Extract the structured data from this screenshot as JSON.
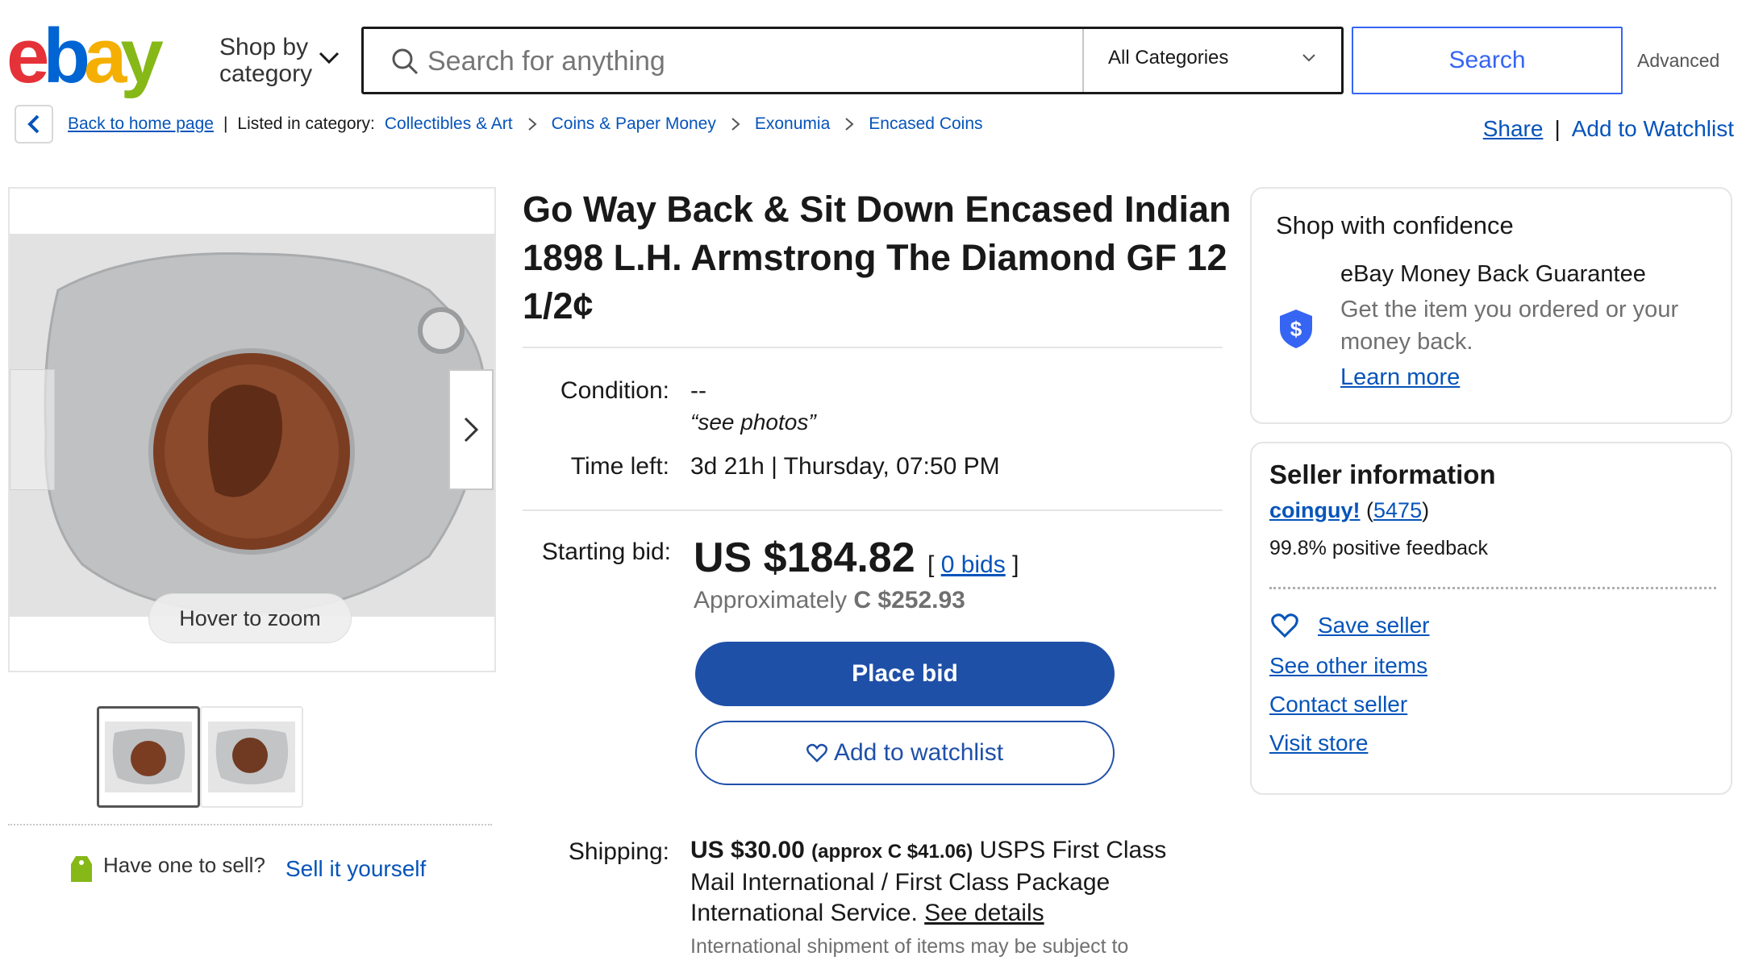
{
  "header": {
    "shop_by": "Shop by",
    "category": "category",
    "search_placeholder": "Search for anything",
    "category_select": "All Categories",
    "search_button": "Search",
    "advanced": "Advanced"
  },
  "breadcrumb": {
    "back_link": "Back to home page",
    "listed_in": "Listed in category:",
    "categories": [
      "Collectibles & Art",
      "Coins & Paper Money",
      "Exonumia",
      "Encased Coins"
    ],
    "share": "Share",
    "add_watchlist": "Add to Watchlist"
  },
  "gallery": {
    "hover_zoom": "Hover to zoom",
    "have_one": "Have one to sell?",
    "sell_link": "Sell it yourself"
  },
  "listing": {
    "title": "Go Way Back & Sit Down Encased Indian 1898 L.H. Armstrong The Diamond GF 12 1/2¢",
    "condition_label": "Condition:",
    "condition_value": "--",
    "condition_note": "“see photos”",
    "time_left_label": "Time left:",
    "time_left_value": "3d 21h | Thursday, 07:50 PM",
    "starting_bid_label": "Starting bid:",
    "price": "US $184.82",
    "bids_open": "[",
    "bids": "0 bids",
    "bids_close": "]",
    "approx_prefix": "Approximately",
    "approx_value": "C $252.93",
    "place_bid": "Place bid",
    "add_to_watchlist": "Add to watchlist",
    "shipping_label": "Shipping:",
    "shipping_price": "US $30.00",
    "shipping_approx": "(approx C $41.06)",
    "shipping_service": "USPS First Class Mail International / First Class Package International Service.",
    "see_details": "See details",
    "shipping_note": "International shipment of items may be subject to"
  },
  "confidence": {
    "title": "Shop with confidence",
    "guarantee_title": "eBay Money Back Guarantee",
    "guarantee_desc": "Get the item you ordered or your money back.",
    "learn_more": "Learn more"
  },
  "seller": {
    "title": "Seller information",
    "name": "coinguy!",
    "feedback_open": "(",
    "feedback_count": "5475",
    "feedback_close": ")",
    "positive": "99.8% positive feedback",
    "save_seller": "Save seller",
    "see_other": "See other items",
    "contact": "Contact seller",
    "visit_store": "Visit store"
  },
  "colors": {
    "link": "#0654ba",
    "primary_button": "#1f50a8",
    "search_button_border": "#3665f3"
  }
}
